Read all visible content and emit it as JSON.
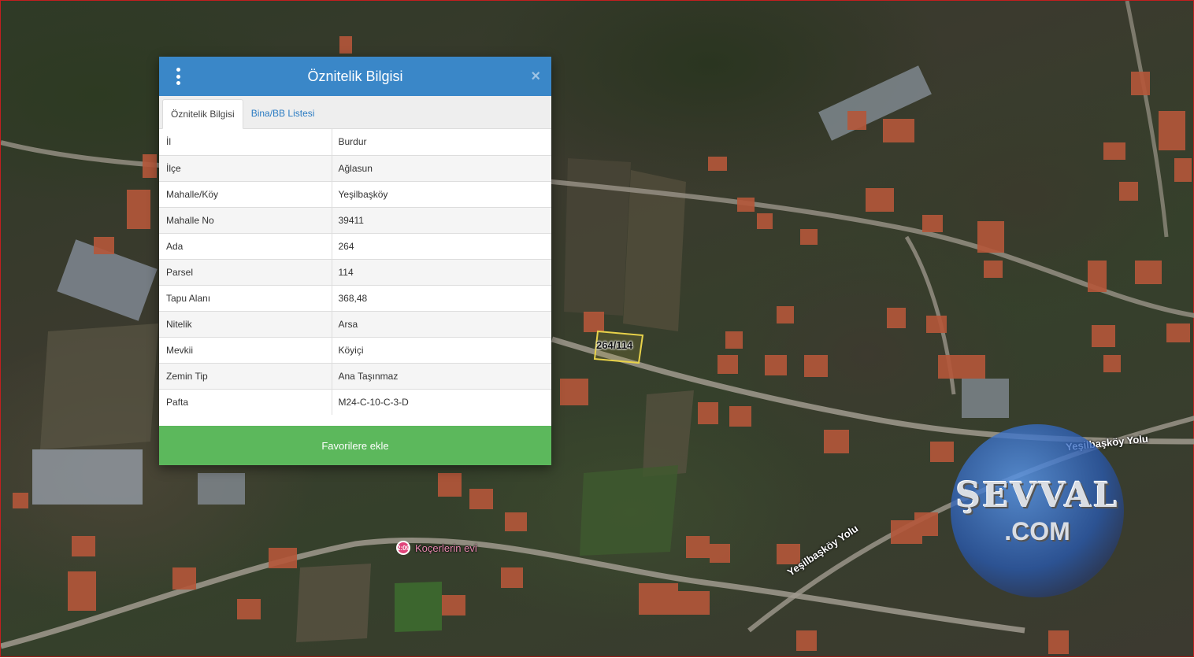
{
  "dialog": {
    "title": "Öznitelik Bilgisi",
    "close_label": "×",
    "menu_icon": "kebab-menu-icon",
    "tabs": [
      {
        "label": "Öznitelik Bilgisi",
        "active": true
      },
      {
        "label": "Bina/BB Listesi",
        "active": false
      }
    ],
    "rows": [
      {
        "key": "İl",
        "value": "Burdur"
      },
      {
        "key": "İlçe",
        "value": "Ağlasun"
      },
      {
        "key": "Mahalle/Köy",
        "value": "Yeşilbaşköy"
      },
      {
        "key": "Mahalle No",
        "value": "39411"
      },
      {
        "key": "Ada",
        "value": "264"
      },
      {
        "key": "Parsel",
        "value": "114"
      },
      {
        "key": "Tapu Alanı",
        "value": "368,48"
      },
      {
        "key": "Nitelik",
        "value": "Arsa"
      },
      {
        "key": "Mevkii",
        "value": "Köyiçi"
      },
      {
        "key": "Zemin Tip",
        "value": "Ana Taşınmaz"
      },
      {
        "key": "Pafta",
        "value": "M24-C-10-C-3-D"
      }
    ],
    "favorite_button": "Favorilere ekle"
  },
  "map": {
    "parcel_label": "264/114",
    "poi": {
      "icon_text": "2:09",
      "label": "Koçerlerin evi"
    },
    "road_labels": [
      "Yeşilbaşköy Yolu",
      "Yeşilbaşköy Yolu"
    ],
    "watermark": {
      "top": "ŞEVVAL",
      "bottom": ".COM"
    }
  },
  "colors": {
    "header": "#3a87c8",
    "favorite_button": "#5cb85c",
    "link": "#2a7bc2"
  }
}
